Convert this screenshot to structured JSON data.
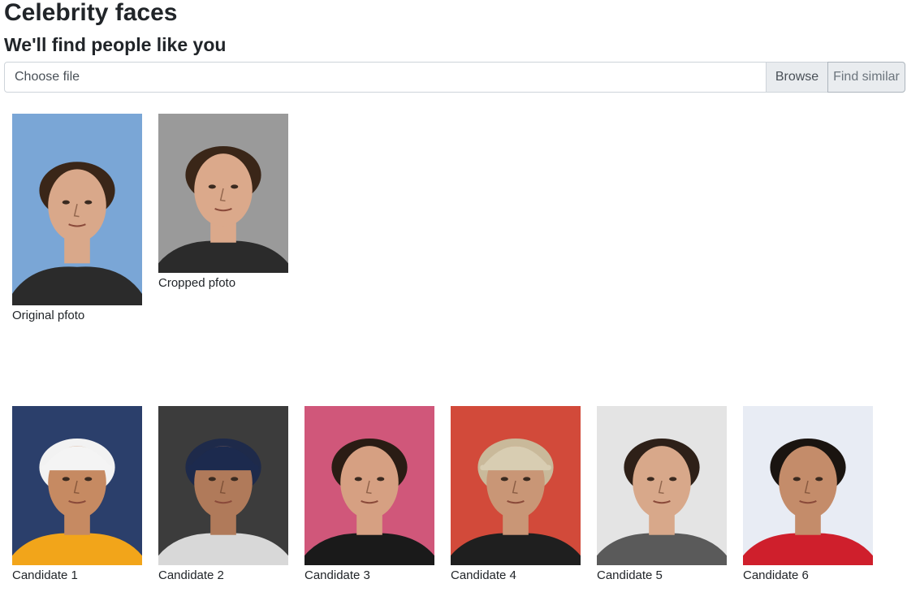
{
  "header": {
    "title": "Celebrity faces",
    "subtitle": "We'll find people like you"
  },
  "upload": {
    "file_placeholder": "Choose file",
    "browse_label": "Browse",
    "find_label": "Find similar"
  },
  "source_photos": [
    {
      "caption": "Original pfoto",
      "bg": "#7aa6d6",
      "hair": "#3a2618",
      "skin": "#d9a88a",
      "shirt": "#2b2b2b"
    },
    {
      "caption": "Cropped pfoto",
      "bg": "#9a9a9a",
      "hair": "#3a2618",
      "skin": "#dba98b",
      "shirt": "#2b2b2b"
    }
  ],
  "candidates": [
    {
      "caption": "Candidate 1",
      "bg": "#2b3f6b",
      "hair": "#f2f2f2",
      "skin": "#c68a62",
      "shirt": "#f2a51a",
      "cap": "white"
    },
    {
      "caption": "Candidate 2",
      "bg": "#3c3c3c",
      "hair": "#1e2a4a",
      "skin": "#b07a5a",
      "shirt": "#d8d8d8",
      "cap": "navy"
    },
    {
      "caption": "Candidate 3",
      "bg": "#d0577a",
      "hair": "#2a1c14",
      "skin": "#d6a082",
      "shirt": "#1a1a1a",
      "cap": "none"
    },
    {
      "caption": "Candidate 4",
      "bg": "#d24a3a",
      "hair": "#c9b99a",
      "skin": "#c99676",
      "shirt": "#1f1f1f",
      "cap": "khaki"
    },
    {
      "caption": "Candidate 5",
      "bg": "#e4e4e4",
      "hair": "#2e2018",
      "skin": "#d8a88a",
      "shirt": "#5a5a5a",
      "cap": "none"
    },
    {
      "caption": "Candidate 6",
      "bg": "#e8ecf4",
      "hair": "#1a1410",
      "skin": "#c48c6a",
      "shirt": "#cf1f2c",
      "cap": "none"
    }
  ]
}
